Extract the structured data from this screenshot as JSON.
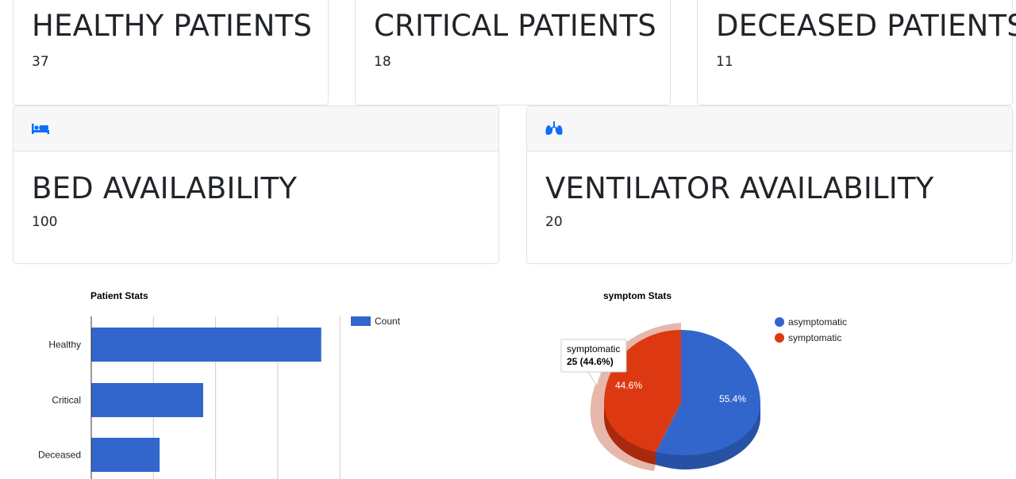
{
  "cards": {
    "healthy": {
      "title": "HEALTHY PATIENTS",
      "value": "37"
    },
    "critical": {
      "title": "CRITICAL PATIENTS",
      "value": "18"
    },
    "deceased": {
      "title": "DECEASED PATIENTS",
      "value": "11"
    },
    "beds": {
      "title": "BED AVAILABILITY",
      "value": "100",
      "icon": "bed-icon"
    },
    "ventilators": {
      "title": "VENTILATOR AVAILABILITY",
      "value": "20",
      "icon": "lungs-icon"
    }
  },
  "colors": {
    "accent": "#0d6efd",
    "blue": "#3366cc",
    "red": "#dc3912"
  },
  "chart_data": [
    {
      "type": "bar",
      "title": "Patient Stats",
      "categories": [
        "Healthy",
        "Critical",
        "Deceased"
      ],
      "series": [
        {
          "name": "Count",
          "values": [
            37,
            18,
            11
          ]
        }
      ],
      "legend": "right"
    },
    {
      "type": "pie",
      "title": "symptom Stats",
      "labels": [
        "asymptomatic",
        "symptomatic"
      ],
      "values": [
        31,
        25
      ],
      "slice_labels": [
        "55.4%",
        "44.6%"
      ],
      "tooltip": {
        "label": "symptomatic",
        "value": "25 (44.6%)"
      },
      "legend": "right"
    }
  ]
}
